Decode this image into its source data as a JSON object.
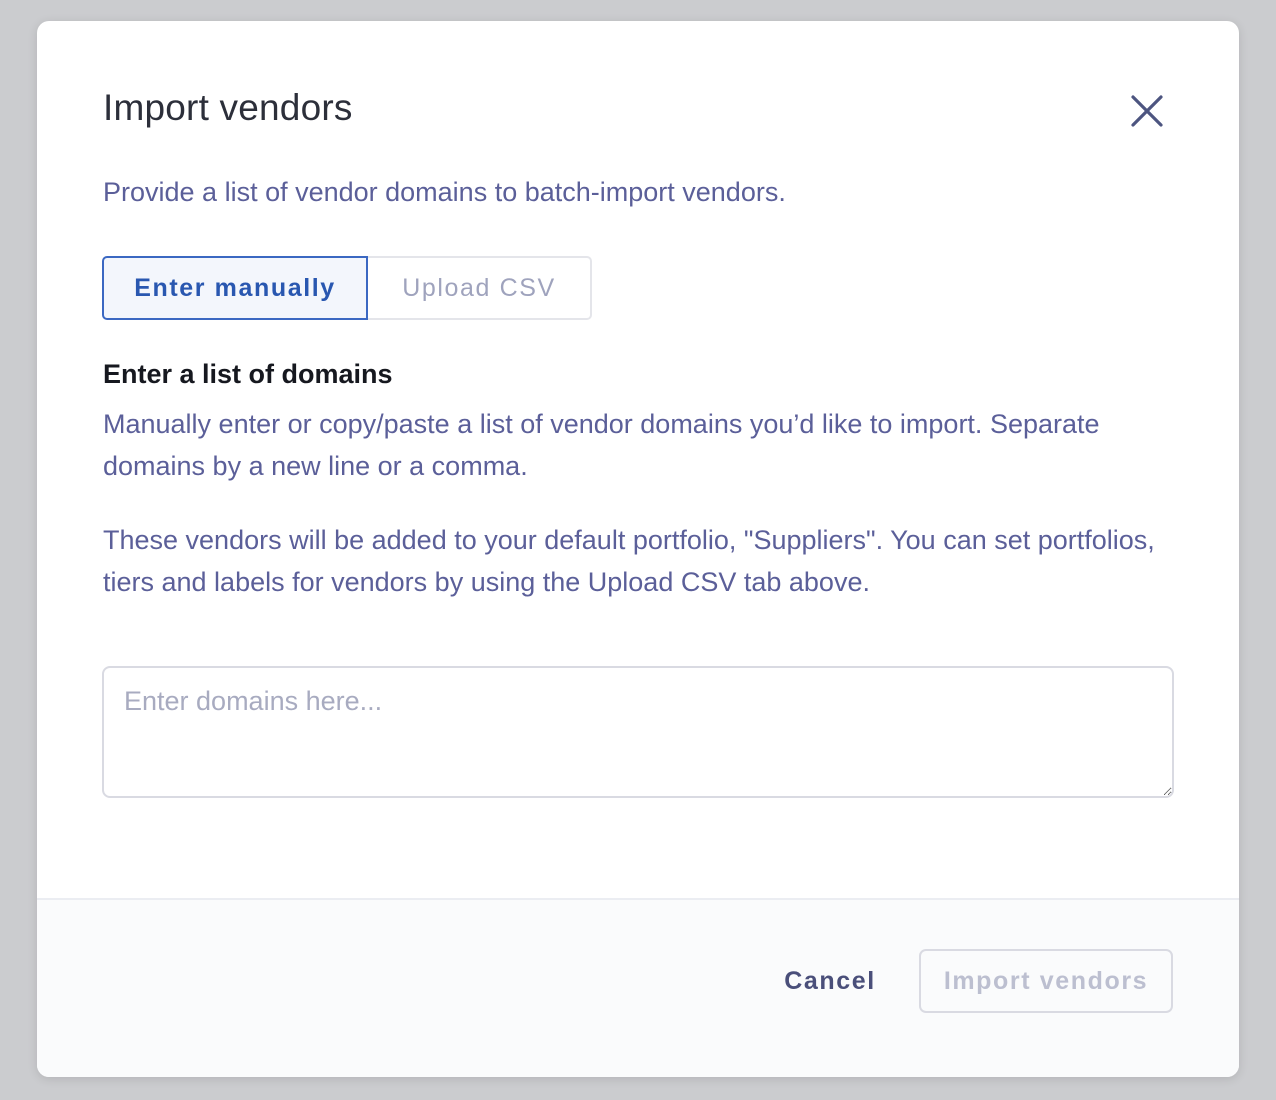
{
  "modal": {
    "title": "Import vendors",
    "intro": "Provide a list of vendor domains to batch-import vendors.",
    "close_icon": "close-icon"
  },
  "tabs": [
    {
      "label": "Enter manually",
      "active": true
    },
    {
      "label": "Upload CSV",
      "active": false
    }
  ],
  "section": {
    "title": "Enter a list of domains",
    "description": "Manually enter or copy/paste a list of vendor domains you’d like to import. Separate domains by a new line or a comma.",
    "note": "These vendors will be added to your default portfolio, \"Suppliers\". You can set portfolios, tiers and labels for vendors by using the Upload CSV tab above."
  },
  "domains_input": {
    "placeholder": "Enter domains here...",
    "value": ""
  },
  "footer": {
    "cancel_label": "Cancel",
    "import_label": "Import vendors",
    "import_disabled": true
  },
  "colors": {
    "accent": "#3b68c2",
    "text_primary": "#2c2f3a",
    "text_secondary": "#5b5f99"
  }
}
